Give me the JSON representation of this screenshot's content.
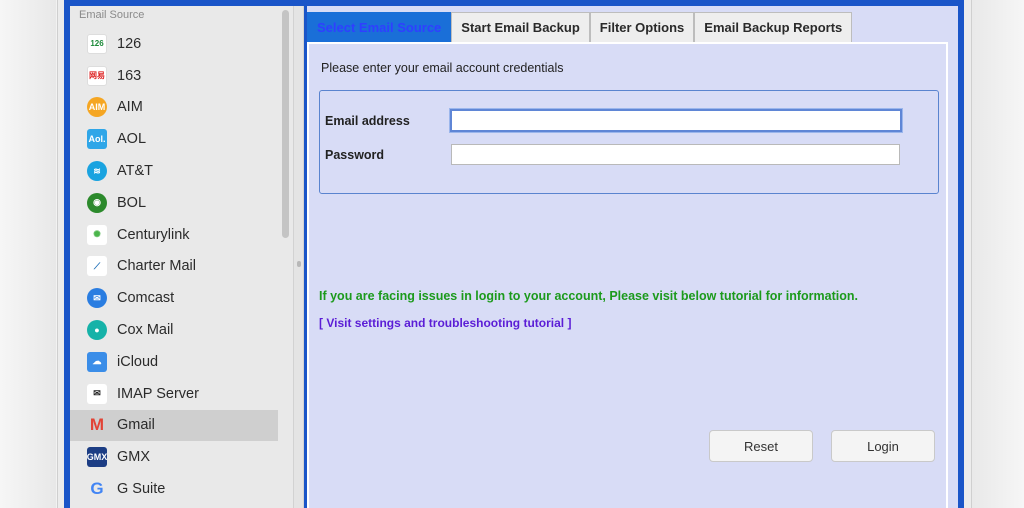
{
  "sidebar": {
    "title": "Email Source",
    "items": [
      {
        "label": "126",
        "icon": "126-icon",
        "color": "#ffffff",
        "selected": false
      },
      {
        "label": "163",
        "icon": "163-icon",
        "color": "#ffffff",
        "selected": false
      },
      {
        "label": "AIM",
        "icon": "aim-icon",
        "color": "#f5a623",
        "selected": false
      },
      {
        "label": "AOL",
        "icon": "aol-icon",
        "color": "#2fa6e8",
        "selected": false
      },
      {
        "label": "AT&T",
        "icon": "att-icon",
        "color": "#1aa3e0",
        "selected": false
      },
      {
        "label": "BOL",
        "icon": "bol-icon",
        "color": "#2c8a2c",
        "selected": false
      },
      {
        "label": "Centurylink",
        "icon": "centurylink-icon",
        "color": "#4bb54b",
        "selected": false
      },
      {
        "label": "Charter Mail",
        "icon": "charter-icon",
        "color": "#1e6fb8",
        "selected": false
      },
      {
        "label": "Comcast",
        "icon": "comcast-icon",
        "color": "#2a7de1",
        "selected": false
      },
      {
        "label": "Cox Mail",
        "icon": "cox-icon",
        "color": "#16b2a8",
        "selected": false
      },
      {
        "label": "iCloud",
        "icon": "icloud-icon",
        "color": "#3a8de8",
        "selected": false
      },
      {
        "label": "IMAP Server",
        "icon": "imap-icon",
        "color": "#333333",
        "selected": false
      },
      {
        "label": "Gmail",
        "icon": "gmail-icon",
        "color": "#e24335",
        "selected": true
      },
      {
        "label": "GMX",
        "icon": "gmx-icon",
        "color": "#1c3d84",
        "selected": false
      },
      {
        "label": "G Suite",
        "icon": "gsuite-icon",
        "color": "#4285f4",
        "selected": false
      }
    ]
  },
  "tabs": [
    {
      "label": "Select Email Source",
      "active": true
    },
    {
      "label": "Start Email Backup",
      "active": false
    },
    {
      "label": "Filter Options",
      "active": false
    },
    {
      "label": "Email Backup Reports",
      "active": false
    }
  ],
  "panel": {
    "prompt": "Please enter your email account credentials",
    "email_label": "Email address",
    "email_value": "",
    "password_label": "Password",
    "password_value": "",
    "help_text": "If you are facing issues in login to your account, Please visit below tutorial for information.",
    "link_text": "[ Visit settings and troubleshooting tutorial ]"
  },
  "buttons": {
    "reset": "Reset",
    "login": "Login"
  },
  "colors": {
    "frame": "#1a55c8",
    "panel_bg": "#d8dcf6",
    "help_green": "#1c9a1c",
    "link_purple": "#5b1dd6"
  }
}
